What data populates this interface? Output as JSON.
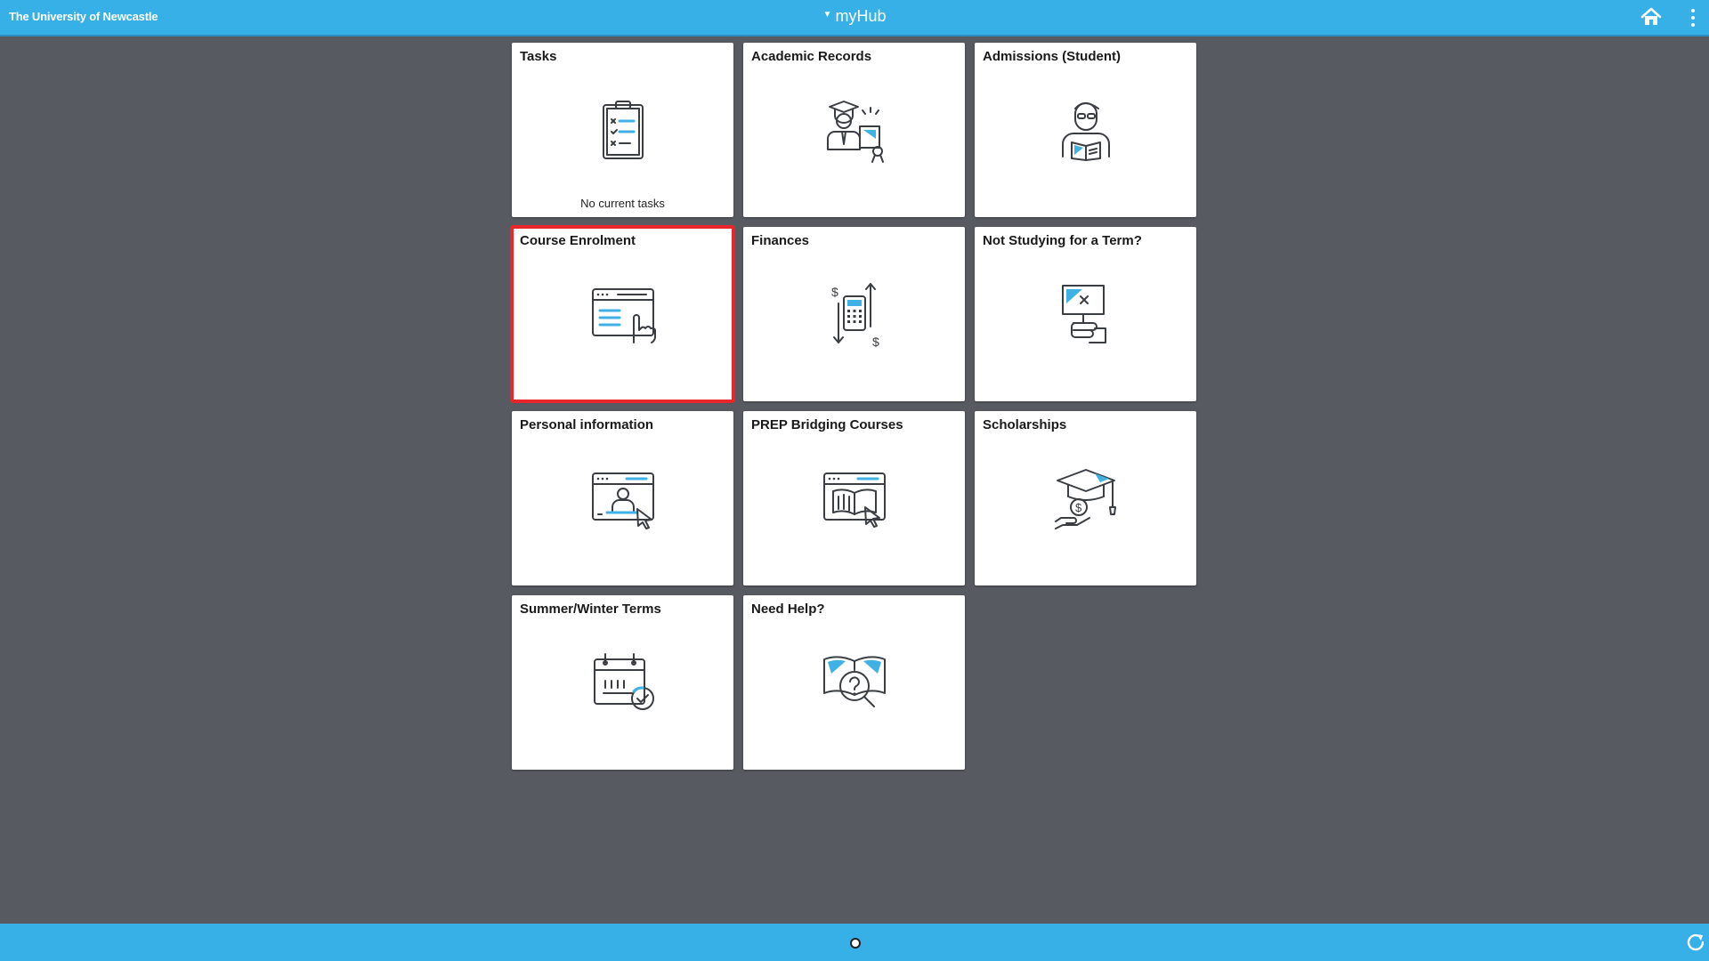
{
  "header": {
    "brand": "The University of Newcastle",
    "title": "myHub",
    "home_icon": "home-icon",
    "menu_icon": "more-vertical-icon"
  },
  "tiles": [
    {
      "title": "Tasks",
      "icon": "clipboard-checklist-icon",
      "subtitle": "No current tasks"
    },
    {
      "title": "Academic Records",
      "icon": "graduate-certificate-icon"
    },
    {
      "title": "Admissions (Student)",
      "icon": "student-reading-icon"
    },
    {
      "title": "Course Enrolment",
      "icon": "browser-hand-click-icon",
      "selected": true
    },
    {
      "title": "Finances",
      "icon": "calculator-dollar-arrows-icon"
    },
    {
      "title": "Not Studying for a Term?",
      "icon": "hand-sign-cross-icon"
    },
    {
      "title": "Personal information",
      "icon": "browser-person-cursor-icon"
    },
    {
      "title": "PREP Bridging Courses",
      "icon": "browser-book-cursor-icon"
    },
    {
      "title": "Scholarships",
      "icon": "graduation-cap-money-hand-icon"
    },
    {
      "title": "Summer/Winter Terms",
      "icon": "calendar-check-icon"
    },
    {
      "title": "Need Help?",
      "icon": "book-question-magnifier-icon"
    }
  ],
  "footer": {
    "page_indicator_icon": "page-dot-icon",
    "refresh_icon": "refresh-icon"
  },
  "colors": {
    "header_bg": "#36b0e6",
    "page_bg": "#575b61",
    "tile_bg": "#ffffff",
    "selected_outline": "#e8262b",
    "icon_accent": "#3fb1e5",
    "icon_stroke": "#3a3d42"
  }
}
